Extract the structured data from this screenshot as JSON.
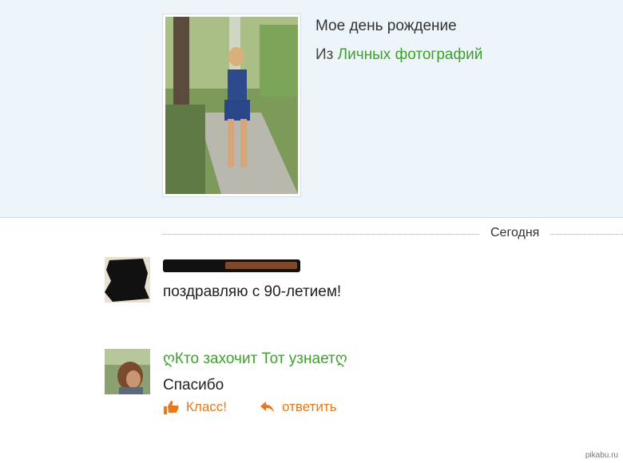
{
  "photo": {
    "title": "Мое день рождение",
    "source_prefix": "Из",
    "source_album": "Личных фотографий"
  },
  "feed": {
    "date_label": "Сегодня"
  },
  "comments": [
    {
      "author": "",
      "text": "поздравляю с 90-летием!"
    },
    {
      "author": "ღКто захочит Тот узнаетღ",
      "text": "Спасибо",
      "actions": {
        "like_label": "Класс!",
        "reply_label": "ответить"
      }
    }
  ],
  "watermark": "pikabu.ru",
  "colors": {
    "link_green": "#3ca12b",
    "action_orange": "#e8781e",
    "panel_bg": "#eef5fa"
  },
  "icons": [
    "thumbs-up-icon",
    "reply-arrow-icon"
  ]
}
